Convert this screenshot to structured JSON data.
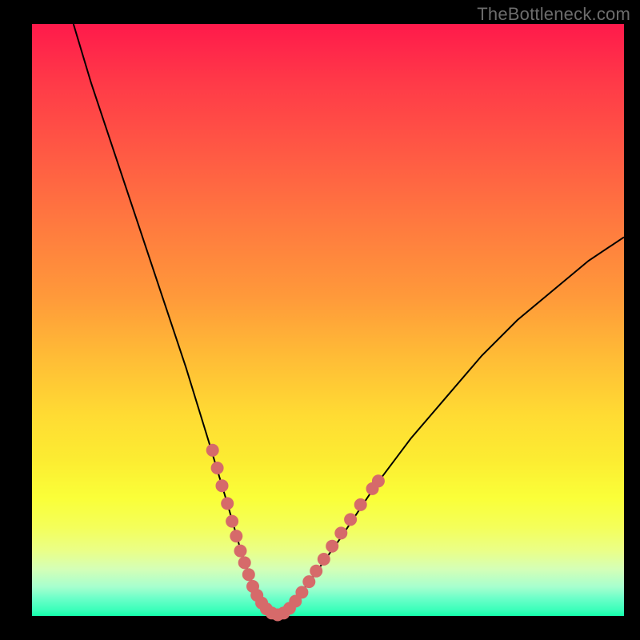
{
  "watermark": "TheBottleneck.com",
  "chart_data": {
    "type": "line",
    "title": "",
    "xlabel": "",
    "ylabel": "",
    "xlim": [
      0,
      100
    ],
    "ylim": [
      0,
      100
    ],
    "grid": false,
    "series": [
      {
        "name": "bottleneck-curve",
        "x": [
          7,
          10,
          14,
          18,
          22,
          26,
          30,
          33,
          35,
          37,
          39,
          40.5,
          42,
          44,
          47,
          52,
          58,
          64,
          70,
          76,
          82,
          88,
          94,
          100
        ],
        "y": [
          100,
          90,
          78,
          66,
          54,
          42,
          29,
          19,
          12,
          6,
          2,
          0,
          0.5,
          2,
          6,
          13,
          22,
          30,
          37,
          44,
          50,
          55,
          60,
          64
        ],
        "color": "#000000"
      }
    ],
    "markers": {
      "name": "selected-range",
      "color": "#d66a6a",
      "points": [
        {
          "x": 30.5,
          "y": 28
        },
        {
          "x": 31.3,
          "y": 25
        },
        {
          "x": 32.1,
          "y": 22
        },
        {
          "x": 33.0,
          "y": 19
        },
        {
          "x": 33.8,
          "y": 16
        },
        {
          "x": 34.5,
          "y": 13.5
        },
        {
          "x": 35.2,
          "y": 11
        },
        {
          "x": 35.9,
          "y": 9
        },
        {
          "x": 36.6,
          "y": 7
        },
        {
          "x": 37.3,
          "y": 5
        },
        {
          "x": 38.0,
          "y": 3.5
        },
        {
          "x": 38.8,
          "y": 2.2
        },
        {
          "x": 39.6,
          "y": 1.2
        },
        {
          "x": 40.5,
          "y": 0.5
        },
        {
          "x": 41.5,
          "y": 0.2
        },
        {
          "x": 42.5,
          "y": 0.5
        },
        {
          "x": 43.5,
          "y": 1.3
        },
        {
          "x": 44.5,
          "y": 2.5
        },
        {
          "x": 45.6,
          "y": 4
        },
        {
          "x": 46.8,
          "y": 5.8
        },
        {
          "x": 48.0,
          "y": 7.6
        },
        {
          "x": 49.3,
          "y": 9.6
        },
        {
          "x": 50.7,
          "y": 11.8
        },
        {
          "x": 52.2,
          "y": 14
        },
        {
          "x": 53.8,
          "y": 16.3
        },
        {
          "x": 55.5,
          "y": 18.8
        },
        {
          "x": 57.5,
          "y": 21.5
        },
        {
          "x": 58.5,
          "y": 22.8
        }
      ]
    },
    "gradient_background": {
      "top_color": "#ff1a4b",
      "mid_color": "#ffdb33",
      "bottom_color": "#15ffaa"
    }
  }
}
